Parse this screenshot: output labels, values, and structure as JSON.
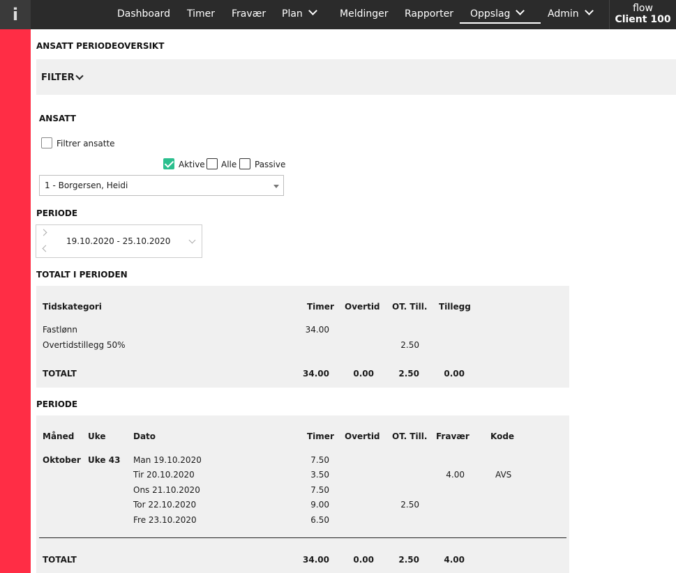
{
  "nav": {
    "logo": "i",
    "items": [
      "Dashboard",
      "Timer",
      "Fravær",
      "Plan",
      "Meldinger",
      "Rapporter",
      "Oppslag",
      "Admin"
    ],
    "client_line1": "flow",
    "client_line2": "Client 100"
  },
  "page": {
    "title": "ANSATT PERIODEOVERSIKT",
    "filter_label": "FILTER",
    "ansatt_title": "ANSATT",
    "filter_employees_label": "Filtrer ansatte",
    "status_options": [
      "Aktive",
      "Alle",
      "Passive"
    ],
    "status_checked": [
      true,
      false,
      false
    ],
    "employee_selected": "1 - Borgersen, Heidi",
    "periode_title": "PERIODE",
    "period_value": "19.10.2020 - 25.10.2020"
  },
  "totals": {
    "title": "TOTALT I PERIODEN",
    "headers": [
      "Tidskategori",
      "Timer",
      "Overtid",
      "OT. Till.",
      "Tillegg"
    ],
    "rows": [
      {
        "category": "Fastlønn",
        "timer": "34.00",
        "overtid": "",
        "ot_till": "",
        "tillegg": ""
      },
      {
        "category": "Overtidstillegg 50%",
        "timer": "",
        "overtid": "",
        "ot_till": "2.50",
        "tillegg": ""
      }
    ],
    "total": {
      "label": "TOTALT",
      "timer": "34.00",
      "overtid": "0.00",
      "ot_till": "2.50",
      "tillegg": "0.00"
    }
  },
  "period": {
    "title": "PERIODE",
    "headers": [
      "Måned",
      "Uke",
      "Dato",
      "Timer",
      "Overtid",
      "OT. Till.",
      "Fravær",
      "Kode"
    ],
    "month": "Oktober",
    "week": "Uke 43",
    "rows": [
      {
        "date": "Man 19.10.2020",
        "timer": "7.50",
        "overtid": "",
        "ot_till": "",
        "fravaer": "",
        "kode": ""
      },
      {
        "date": "Tir 20.10.2020",
        "timer": "3.50",
        "overtid": "",
        "ot_till": "",
        "fravaer": "4.00",
        "kode": "AVS"
      },
      {
        "date": "Ons 21.10.2020",
        "timer": "7.50",
        "overtid": "",
        "ot_till": "",
        "fravaer": "",
        "kode": ""
      },
      {
        "date": "Tor 22.10.2020",
        "timer": "9.00",
        "overtid": "",
        "ot_till": "2.50",
        "fravaer": "",
        "kode": ""
      },
      {
        "date": "Fre 23.10.2020",
        "timer": "6.50",
        "overtid": "",
        "ot_till": "",
        "fravaer": "",
        "kode": ""
      }
    ],
    "total": {
      "label": "TOTALT",
      "timer": "34.00",
      "overtid": "0.00",
      "ot_till": "2.50",
      "fravaer": "4.00"
    }
  },
  "colors": {
    "accent_red": "#ff2d45",
    "topbar": "#2b2b2b",
    "check_green": "#2bbf8e",
    "panel_bg": "#f0f0f0"
  }
}
